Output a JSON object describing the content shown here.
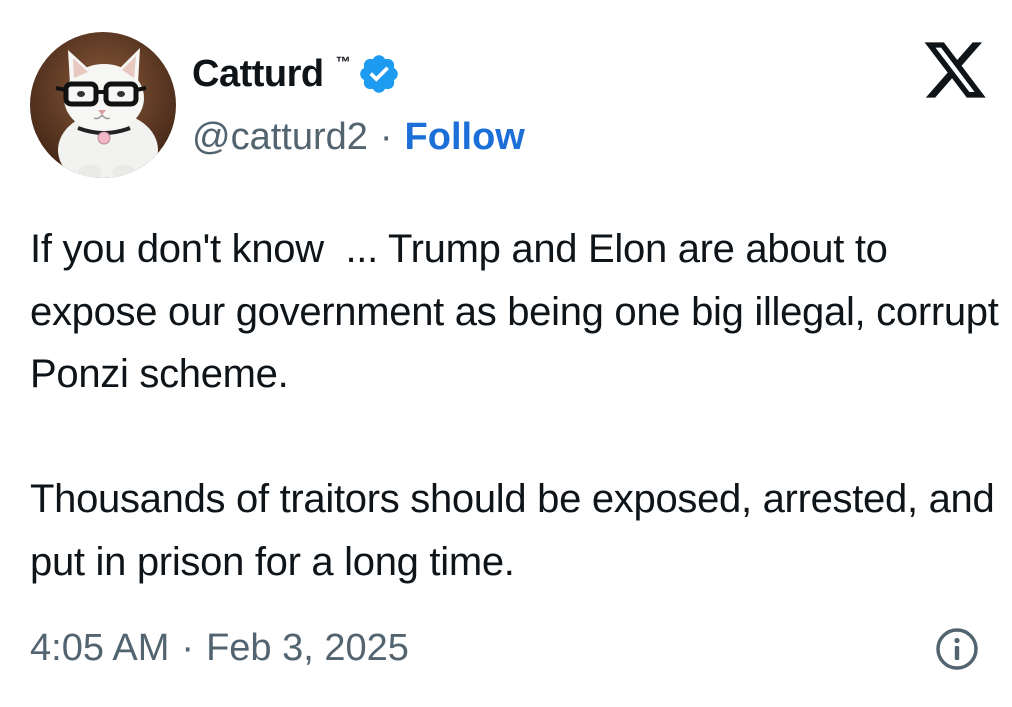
{
  "tweet": {
    "author": {
      "display_name": "Catturd",
      "trademark": "™",
      "handle": "@catturd2",
      "separator": "·",
      "follow_label": "Follow",
      "verified": true,
      "avatar_icon": "cat-with-glasses-avatar"
    },
    "platform_icon": "x-logo-icon",
    "text": "If you don't know  ... Trump and Elon are about to expose our government as being one big illegal, corrupt Ponzi scheme.\n\nThousands of traitors should be exposed, arrested, and put in prison for a long time.",
    "time": "4:05 AM",
    "date_separator": "·",
    "date": "Feb 3, 2025",
    "info_icon": "info-icon"
  },
  "colors": {
    "text": "#0f1419",
    "secondary_text": "#536471",
    "link_blue": "#1d6fd8",
    "verified_blue": "#1d9bf0"
  }
}
